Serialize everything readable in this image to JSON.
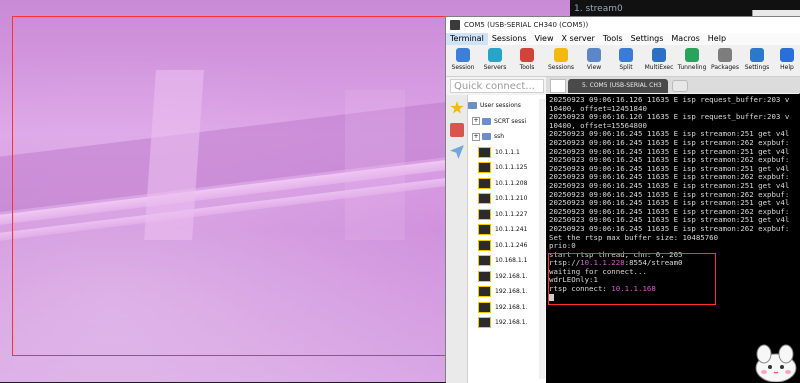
{
  "background": {
    "stream_tab_label": "1. stream0"
  },
  "window": {
    "title": "COM5  (USB-SERIAL CH340 (COM5))",
    "menu": [
      "Terminal",
      "Sessions",
      "View",
      "X server",
      "Tools",
      "Settings",
      "Macros",
      "Help"
    ],
    "toolbar": [
      {
        "label": "Session",
        "icon": "session-icon",
        "color": "#3d7fd8"
      },
      {
        "label": "Servers",
        "icon": "servers-icon",
        "color": "#2aa3c9"
      },
      {
        "label": "Tools",
        "icon": "tools-icon",
        "color": "#d0453a"
      },
      {
        "label": "Sessions",
        "icon": "star-icon",
        "color": "#f2b90f"
      },
      {
        "label": "View",
        "icon": "view-icon",
        "color": "#5b86c9"
      },
      {
        "label": "Split",
        "icon": "split-icon",
        "color": "#3a7bd5"
      },
      {
        "label": "MultiExec",
        "icon": "multiexec-icon",
        "color": "#2f6fc2"
      },
      {
        "label": "Tunneling",
        "icon": "tunneling-icon",
        "color": "#29a35b"
      },
      {
        "label": "Packages",
        "icon": "packages-icon",
        "color": "#7d7d7d"
      },
      {
        "label": "Settings",
        "icon": "gear-icon",
        "color": "#2d78c9"
      },
      {
        "label": "Help",
        "icon": "help-icon",
        "color": "#2a6fd8"
      }
    ],
    "quick_connect_placeholder": "Quick connect..."
  },
  "sidebar": {
    "tree": [
      {
        "type": "root",
        "label": "User sessions"
      },
      {
        "type": "folder",
        "label": "SCRT sessi"
      },
      {
        "type": "folder",
        "label": "ssh"
      },
      {
        "type": "session",
        "label": "10.1.1.1"
      },
      {
        "type": "session",
        "label": "10.1.1.125"
      },
      {
        "type": "session",
        "label": "10.1.1.208"
      },
      {
        "type": "session",
        "label": "10.1.1.210"
      },
      {
        "type": "session",
        "label": "10.1.1.227"
      },
      {
        "type": "session",
        "label": "10.1.1.241"
      },
      {
        "type": "session",
        "label": "10.1.1.246"
      },
      {
        "type": "session",
        "label": "10.168.1.1"
      },
      {
        "type": "session",
        "label": "192.168.1."
      },
      {
        "type": "session",
        "label": "192.168.1."
      },
      {
        "type": "session",
        "label": "192.168.1."
      },
      {
        "type": "session",
        "label": "192.168.1."
      }
    ]
  },
  "tabs": {
    "active_tab": "5. COM5  (USB-SERIAL CH3"
  },
  "terminal": {
    "lines": [
      "20250923 09:06:16.126 11635 E isp request_buffer:203 v",
      "10400, offset=12451840",
      "20250923 09:06:16.126 11635 E isp request_buffer:203 v",
      "10400, offset=15564800",
      "20250923 09:06:16.245 11635 E isp streamon:251 get v4l",
      "20250923 09:06:16.245 11635 E isp streamon:262 expbuf:",
      "20250923 09:06:16.245 11635 E isp streamon:251 get v4l",
      "20250923 09:06:16.245 11635 E isp streamon:262 expbuf:",
      "20250923 09:06:16.245 11635 E isp streamon:251 get v4l",
      "20250923 09:06:16.245 11635 E isp streamon:262 expbuf:",
      "20250923 09:06:16.245 11635 E isp streamon:251 get v4l",
      "20250923 09:06:16.245 11635 E isp streamon:262 expbuf:",
      "20250923 09:06:16.245 11635 E isp streamon:251 get v4l",
      "20250923 09:06:16.245 11635 E isp streamon:262 expbuf:",
      "20250923 09:06:16.245 11635 E isp streamon:251 get v4l",
      "20250923 09:06:16.245 11635 E isp streamon:262 expbuf:",
      "Set the rtsp max buffer size: 10485760",
      "prio:0"
    ],
    "highlight": {
      "line1": "start rtsp thread, chn: 0, 265",
      "rtsp_prefix": "rtsp://",
      "rtsp_ip": "10.1.1.228",
      "rtsp_suffix": ":8554/stream0",
      "line3": "waiting for connect...",
      "line4": "wdrLEOnly:1",
      "connect_prefix": "rtsp connect: ",
      "connect_ip": "10.1.1.168"
    }
  },
  "colors": {
    "highlight_ip": "#d35bd3",
    "annotation_box": "#ff3030"
  }
}
